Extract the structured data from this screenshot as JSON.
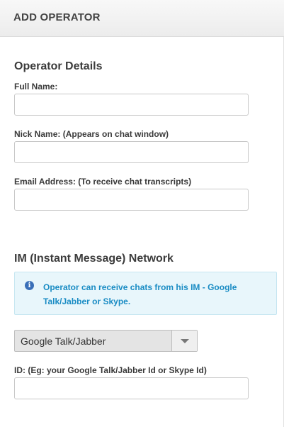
{
  "header": {
    "title": "ADD OPERATOR"
  },
  "operator_details": {
    "title": "Operator Details",
    "full_name": {
      "label": "Full Name:",
      "value": "",
      "placeholder": ""
    },
    "nick_name": {
      "label": "Nick Name: (Appears on chat window)",
      "value": "",
      "placeholder": ""
    },
    "email": {
      "label": "Email Address: (To receive chat transcripts)",
      "value": "",
      "placeholder": ""
    }
  },
  "im_network": {
    "title": "IM (Instant Message) Network",
    "info": {
      "icon": "info-icon",
      "text": "Operator can receive chats from his IM - Google Talk/Jabber or Skype."
    },
    "network_select": {
      "selected": "Google Talk/Jabber",
      "icon": "chevron-down-icon"
    },
    "id_field": {
      "label": "ID: (Eg: your Google Talk/Jabber Id or Skype Id)",
      "value": "",
      "placeholder": ""
    }
  },
  "colors": {
    "info_background": "#e8f6fb",
    "info_text": "#1a8cc4",
    "info_icon": "#3a6fb8",
    "header_background": "#f1f1f1"
  }
}
